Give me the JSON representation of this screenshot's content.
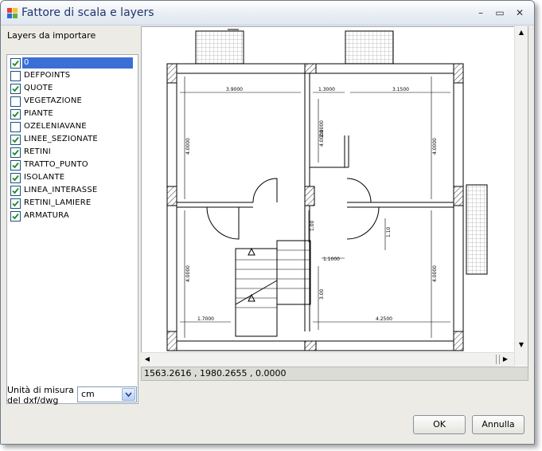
{
  "window": {
    "title": "Fattore di scala e layers"
  },
  "controls": {
    "minimize": "–",
    "maximize": "▭",
    "close": "✕"
  },
  "layers_label": "Layers da importare",
  "layers": [
    {
      "name": "0",
      "checked": true,
      "selected": true
    },
    {
      "name": "DEFPOINTS",
      "checked": false,
      "selected": false
    },
    {
      "name": "QUOTE",
      "checked": true,
      "selected": false
    },
    {
      "name": "VEGETAZIONE",
      "checked": false,
      "selected": false
    },
    {
      "name": "PIANTE",
      "checked": true,
      "selected": false
    },
    {
      "name": "OZELENIAVANE",
      "checked": false,
      "selected": false
    },
    {
      "name": "LINEE_SEZIONATE",
      "checked": true,
      "selected": false
    },
    {
      "name": "RETINI",
      "checked": true,
      "selected": false
    },
    {
      "name": "TRATTO_PUNTO",
      "checked": true,
      "selected": false
    },
    {
      "name": "ISOLANTE",
      "checked": true,
      "selected": false
    },
    {
      "name": "LINEA_INTERASSE",
      "checked": true,
      "selected": false
    },
    {
      "name": "RETINI_LAMIERE",
      "checked": true,
      "selected": false
    },
    {
      "name": "ARMATURA",
      "checked": true,
      "selected": false
    }
  ],
  "coordinates": "1563.2616 , 1980.2655 , 0.0000",
  "unit_label_line1": "Unità di misura",
  "unit_label_line2": "del dxf/dwg",
  "unit": {
    "selected": "cm"
  },
  "dimensions": {
    "d1": "3.9000",
    "d2": "1.3000",
    "d3": "3.1500",
    "d4": "4.0000",
    "d5": "2.8000",
    "d6": "4.0000",
    "d7": "4.0000",
    "d8": "1.00",
    "d9": "1.10",
    "d10": "1.1000",
    "d11": "4.0000",
    "d12": "3.00",
    "d13": "4.0000",
    "d14": "1.7000",
    "d15": "4.2500"
  },
  "buttons": {
    "ok": "OK",
    "cancel": "Annulla"
  },
  "colors": {
    "title_text": "#20356b",
    "selection": "#3a6fd6",
    "check": "#1f8a1f"
  }
}
